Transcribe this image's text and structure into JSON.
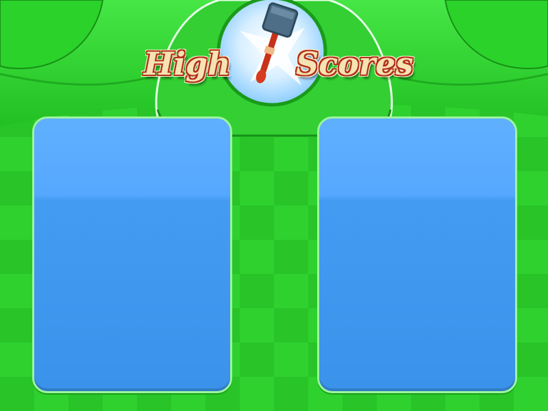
{
  "title": {
    "word1": "High",
    "word2": "Scores"
  },
  "icons": {
    "emblem": "hammer-icon"
  },
  "colors": {
    "green": "#2fd12f",
    "blue_panel": "#449cf2",
    "title_text": "#f6e3b3",
    "title_outline": "#b3301a"
  }
}
